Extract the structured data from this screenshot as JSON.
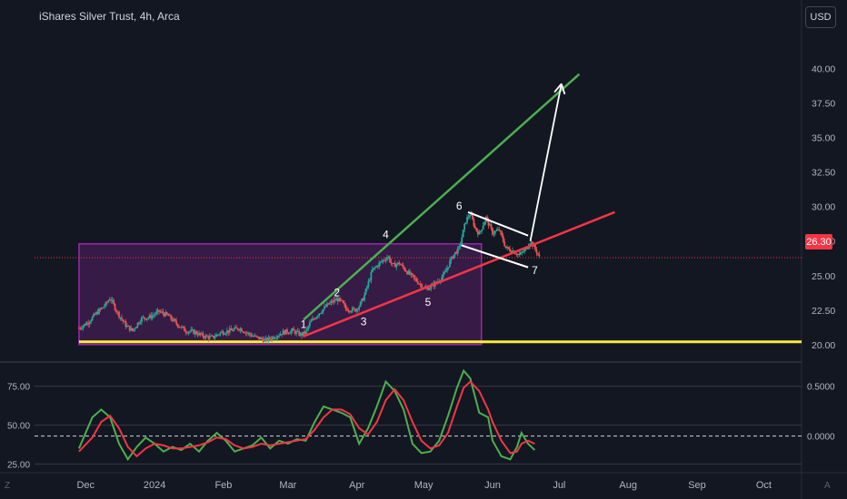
{
  "header": {
    "title": "iShares Silver Trust, 4h, Arca",
    "currency_button": "USD"
  },
  "last_price": "26.30",
  "corner_icons": {
    "left": "Z",
    "right": "A"
  },
  "colors": {
    "background": "#131722",
    "up": "#26a69a",
    "down": "#ef5350",
    "range_box": "#9c27b0",
    "trend_green": "#4caf50",
    "trend_red": "#f23645",
    "support": "#ffeb3b",
    "osc_fast": "#4caf50",
    "osc_slow": "#f23645"
  },
  "chart_data": [
    {
      "type": "candlestick",
      "title": "iShares Silver Trust, 4h, Arca",
      "ylim": [
        19.0,
        43.0
      ],
      "y_ticks": [
        "40.00",
        "37.50",
        "35.00",
        "32.50",
        "30.00",
        "27.50",
        "25.00",
        "22.50",
        "20.00"
      ],
      "x_ticks": [
        "Dec",
        "2024",
        "Feb",
        "Mar",
        "Apr",
        "May",
        "Jun",
        "Jul",
        "Aug",
        "Sep",
        "Oct"
      ],
      "last_price": 26.3,
      "price_path": [
        [
          0,
          21.2
        ],
        [
          4,
          21.6
        ],
        [
          8,
          22.3
        ],
        [
          12,
          22.9
        ],
        [
          14,
          23.4
        ],
        [
          17,
          22.4
        ],
        [
          21,
          21.4
        ],
        [
          24,
          21.0
        ],
        [
          28,
          21.9
        ],
        [
          32,
          22.0
        ],
        [
          36,
          22.4
        ],
        [
          40,
          22.1
        ],
        [
          44,
          21.5
        ],
        [
          48,
          21.0
        ],
        [
          52,
          20.9
        ],
        [
          56,
          20.6
        ],
        [
          60,
          20.5
        ],
        [
          64,
          20.9
        ],
        [
          68,
          21.0
        ],
        [
          72,
          21.2
        ],
        [
          76,
          20.8
        ],
        [
          80,
          20.5
        ],
        [
          84,
          20.3
        ],
        [
          88,
          20.6
        ],
        [
          92,
          20.9
        ],
        [
          96,
          21.0
        ],
        [
          100,
          20.7
        ],
        [
          102,
          20.9
        ],
        [
          104,
          21.6
        ],
        [
          108,
          22.3
        ],
        [
          112,
          22.9
        ],
        [
          116,
          23.3
        ],
        [
          118,
          23.1
        ],
        [
          120,
          22.6
        ],
        [
          124,
          22.5
        ],
        [
          126,
          22.8
        ],
        [
          128,
          23.4
        ],
        [
          130,
          24.4
        ],
        [
          132,
          25.4
        ],
        [
          134,
          25.7
        ],
        [
          136,
          26.0
        ],
        [
          139,
          26.4
        ],
        [
          141,
          25.7
        ],
        [
          144,
          25.9
        ],
        [
          148,
          25.2
        ],
        [
          152,
          24.6
        ],
        [
          156,
          24.0
        ],
        [
          160,
          24.4
        ],
        [
          164,
          25.0
        ],
        [
          168,
          26.4
        ],
        [
          171,
          27.0
        ],
        [
          174,
          29.0
        ],
        [
          176,
          29.5
        ],
        [
          178,
          28.5
        ],
        [
          180,
          28.0
        ],
        [
          183,
          29.2
        ],
        [
          186,
          28.1
        ],
        [
          189,
          28.3
        ],
        [
          192,
          27.0
        ],
        [
          195,
          26.8
        ],
        [
          198,
          26.5
        ],
        [
          201,
          26.9
        ],
        [
          203,
          27.5
        ],
        [
          206,
          26.7
        ],
        [
          207,
          26.3
        ]
      ],
      "annotations": {
        "range_box": {
          "from_day": 0,
          "to_day": 181,
          "low": 20.0,
          "high": 27.3
        },
        "wave_labels": [
          {
            "label": "1",
            "day": 101,
            "price": 21.2
          },
          {
            "label": "2",
            "day": 116,
            "price": 23.5
          },
          {
            "label": "3",
            "day": 128,
            "price": 21.4
          },
          {
            "label": "4",
            "day": 138,
            "price": 27.7
          },
          {
            "label": "5",
            "day": 157,
            "price": 22.8
          },
          {
            "label": "6",
            "day": 171,
            "price": 29.8
          },
          {
            "label": "7",
            "day": 205,
            "price": 25.1
          }
        ],
        "support_level": 20.2,
        "trend_lines": [
          {
            "name": "green",
            "from": [
              101,
              21.8
            ],
            "to": [
              225,
              39.6
            ]
          },
          {
            "name": "red",
            "from": [
              101,
              20.6
            ],
            "to": [
              241,
              29.6
            ]
          }
        ],
        "flag_lines": [
          {
            "from": [
              175,
              29.6
            ],
            "to": [
              202,
              27.9
            ]
          },
          {
            "from": [
              172,
              27.2
            ],
            "to": [
              202,
              25.6
            ]
          }
        ],
        "target_arrow": {
          "from": [
            203,
            27.5
          ],
          "to": [
            217,
            38.9
          ]
        }
      }
    },
    {
      "type": "line",
      "ylim": [
        20,
        90
      ],
      "left_ticks": [
        "75.00",
        "50.00",
        "25.00"
      ],
      "right_ticks": [
        "0.5000",
        "0.0000"
      ],
      "reference_level": 43,
      "series": [
        {
          "color": "fast",
          "values": [
            [
              0,
              35
            ],
            [
              6,
              55
            ],
            [
              10,
              60
            ],
            [
              14,
              55
            ],
            [
              18,
              38
            ],
            [
              22,
              28
            ],
            [
              26,
              36
            ],
            [
              30,
              42
            ],
            [
              34,
              38
            ],
            [
              38,
              33
            ],
            [
              42,
              36
            ],
            [
              46,
              34
            ],
            [
              50,
              38
            ],
            [
              54,
              33
            ],
            [
              58,
              40
            ],
            [
              62,
              45
            ],
            [
              66,
              40
            ],
            [
              70,
              33
            ],
            [
              74,
              35
            ],
            [
              78,
              37
            ],
            [
              82,
              42
            ],
            [
              86,
              35
            ],
            [
              90,
              40
            ],
            [
              94,
              38
            ],
            [
              98,
              41
            ],
            [
              102,
              40
            ],
            [
              106,
              52
            ],
            [
              110,
              62
            ],
            [
              114,
              60
            ],
            [
              118,
              58
            ],
            [
              122,
              55
            ],
            [
              126,
              38
            ],
            [
              130,
              48
            ],
            [
              134,
              62
            ],
            [
              138,
              78
            ],
            [
              142,
              72
            ],
            [
              146,
              60
            ],
            [
              150,
              38
            ],
            [
              154,
              32
            ],
            [
              158,
              33
            ],
            [
              162,
              40
            ],
            [
              166,
              56
            ],
            [
              170,
              74
            ],
            [
              173,
              85
            ],
            [
              176,
              80
            ],
            [
              180,
              58
            ],
            [
              184,
              55
            ],
            [
              186,
              40
            ],
            [
              190,
              30
            ],
            [
              194,
              28
            ],
            [
              197,
              36
            ],
            [
              199,
              45
            ],
            [
              202,
              38
            ],
            [
              205,
              34
            ]
          ]
        },
        {
          "color": "slow",
          "values": [
            [
              0,
              33
            ],
            [
              6,
              42
            ],
            [
              10,
              52
            ],
            [
              14,
              56
            ],
            [
              18,
              48
            ],
            [
              22,
              36
            ],
            [
              26,
              30
            ],
            [
              30,
              35
            ],
            [
              34,
              38
            ],
            [
              38,
              37
            ],
            [
              42,
              35
            ],
            [
              46,
              35
            ],
            [
              50,
              36
            ],
            [
              54,
              37
            ],
            [
              58,
              39
            ],
            [
              62,
              42
            ],
            [
              66,
              41
            ],
            [
              70,
              37
            ],
            [
              74,
              35
            ],
            [
              78,
              36
            ],
            [
              82,
              38
            ],
            [
              86,
              37
            ],
            [
              90,
              38
            ],
            [
              94,
              39
            ],
            [
              98,
              40
            ],
            [
              102,
              41
            ],
            [
              106,
              47
            ],
            [
              110,
              55
            ],
            [
              114,
              60
            ],
            [
              118,
              60
            ],
            [
              122,
              57
            ],
            [
              126,
              48
            ],
            [
              130,
              44
            ],
            [
              134,
              52
            ],
            [
              138,
              66
            ],
            [
              142,
              73
            ],
            [
              146,
              66
            ],
            [
              150,
              52
            ],
            [
              154,
              40
            ],
            [
              158,
              35
            ],
            [
              162,
              37
            ],
            [
              166,
              45
            ],
            [
              170,
              62
            ],
            [
              173,
              74
            ],
            [
              176,
              78
            ],
            [
              180,
              72
            ],
            [
              184,
              60
            ],
            [
              186,
              52
            ],
            [
              190,
              40
            ],
            [
              194,
              32
            ],
            [
              197,
              33
            ],
            [
              199,
              38
            ],
            [
              202,
              40
            ],
            [
              205,
              38
            ]
          ]
        }
      ]
    }
  ]
}
